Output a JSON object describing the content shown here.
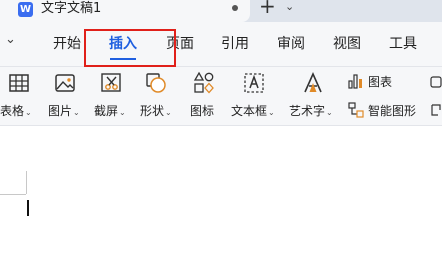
{
  "window": {
    "logo_letter": "W",
    "doc_title": "文字文稿1",
    "new_tab_symbol": "+",
    "new_tab_dropdown": "⌄"
  },
  "menu": {
    "collapse_symbol": "⌄",
    "items": [
      {
        "label": "开始"
      },
      {
        "label": "插入",
        "active": true
      },
      {
        "label": "页面"
      },
      {
        "label": "引用"
      },
      {
        "label": "审阅"
      },
      {
        "label": "视图"
      },
      {
        "label": "工具"
      }
    ]
  },
  "toolbar": {
    "tools": [
      {
        "label": "表格",
        "icon": "table-icon",
        "dropdown": true
      },
      {
        "label": "图片",
        "icon": "picture-icon",
        "dropdown": true
      },
      {
        "label": "截屏",
        "icon": "screenshot-icon",
        "dropdown": true
      },
      {
        "label": "形状",
        "icon": "shapes-icon",
        "dropdown": true
      },
      {
        "label": "图标",
        "icon": "icons-icon",
        "dropdown": false
      },
      {
        "label": "文本框",
        "icon": "textbox-icon",
        "dropdown": true
      },
      {
        "label": "艺术字",
        "icon": "wordart-icon",
        "dropdown": true
      }
    ],
    "chart_label": "图表",
    "smartart_label": "智能图形",
    "dropdown_symbol": "⌄"
  },
  "colors": {
    "accent": "#1f5fe0",
    "highlight": "#e0201a",
    "toolbar_bg": "#f6f7f9",
    "tab_bar_bg": "#dfe4ec"
  }
}
